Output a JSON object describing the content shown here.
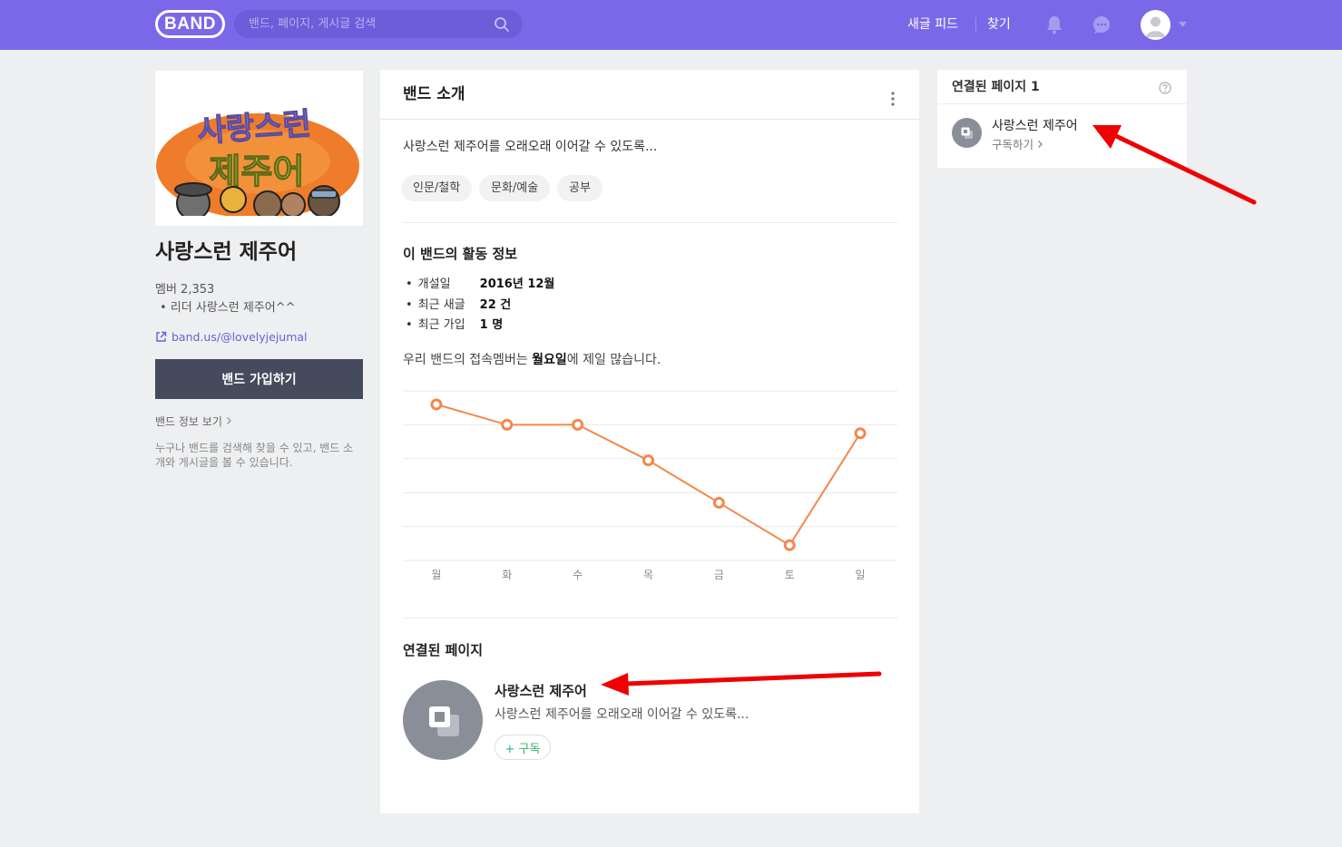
{
  "header": {
    "logo": "BAND",
    "search_placeholder": "밴드, 페이지, 게시글 검색",
    "nav_new_feed": "새글 피드",
    "nav_find": "찾기",
    "brand_color": "#7b68e8"
  },
  "sidebar": {
    "band_name": "사랑스런 제주어",
    "members": "멤버 2,353",
    "leader": "• 리더 사랑스런 제주어^^",
    "url": "band.us/@lovelyjejumal",
    "join_button": "밴드 가입하기",
    "info_link": "밴드 정보 보기",
    "public_desc": "누구나 밴드를 검색해 찾을 수 있고, 밴드 소개와 게시글을 볼 수 있습니다.",
    "cover_text_top": "사랑스런",
    "cover_text_bottom": "제주어"
  },
  "intro_card": {
    "title": "밴드 소개",
    "intro_text": "사랑스런 제주어를 오래오래 이어갈 수 있도록...",
    "tags": [
      "인문/철학",
      "문화/예술",
      "공부"
    ],
    "activity_title": "이 밴드의 활동 정보",
    "stats": [
      {
        "label": "개설일",
        "value": "2016년 12월"
      },
      {
        "label": "최근 새글",
        "value": "22 건"
      },
      {
        "label": "최근 가입",
        "value": "1 명"
      }
    ],
    "peak_prefix": "우리 밴드의 접속멤버는 ",
    "peak_day": "월요일",
    "peak_suffix": "에 제일 많습니다.",
    "linked_title": "연결된 페이지",
    "linked_page": {
      "name": "사랑스런 제주어",
      "desc": "사랑스런 제주어를 오래오래 이어갈 수 있도록...",
      "subscribe": "+ 구독"
    }
  },
  "chart_data": {
    "type": "line",
    "categories": [
      "월",
      "화",
      "수",
      "목",
      "금",
      "토",
      "일"
    ],
    "values": [
      92,
      80,
      80,
      59,
      34,
      9,
      75
    ],
    "ylim": [
      0,
      100
    ],
    "grid": true,
    "color": "#f4874b"
  },
  "right_panel": {
    "title": "연결된 페이지 1",
    "page_name": "사랑스런 제주어",
    "subscribe_link": "구독하기"
  }
}
